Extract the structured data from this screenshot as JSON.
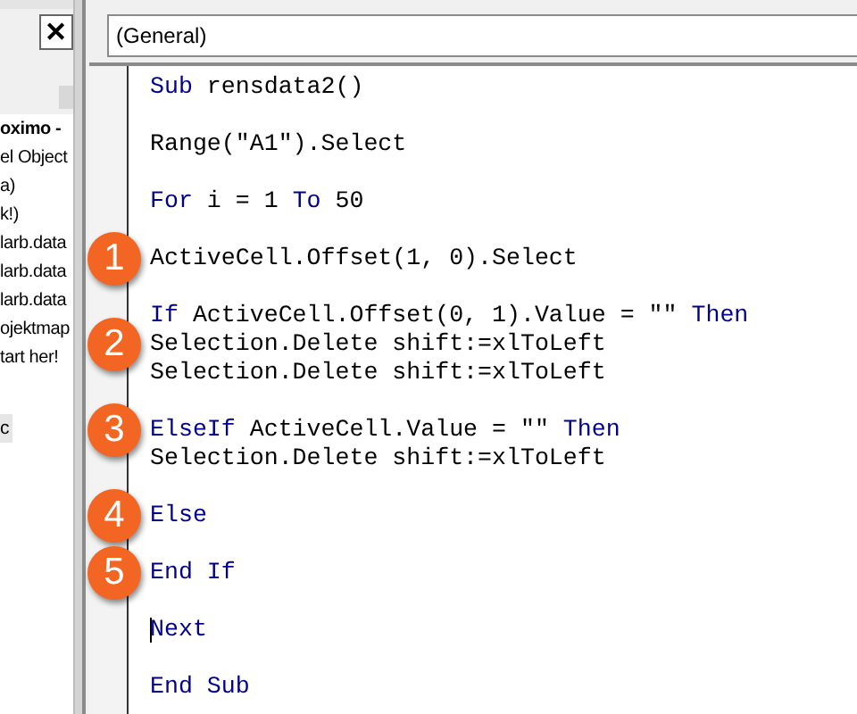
{
  "project_panel": {
    "close": "✕",
    "items": [
      {
        "label": "oximo -",
        "bold": true,
        "selected": false
      },
      {
        "label": "el Object",
        "bold": false,
        "selected": false
      },
      {
        "label": "a)",
        "bold": false,
        "selected": false
      },
      {
        "label": "k!)",
        "bold": false,
        "selected": false
      },
      {
        "label": "larb.data",
        "bold": false,
        "selected": false
      },
      {
        "label": "larb.data",
        "bold": false,
        "selected": false
      },
      {
        "label": "larb.data",
        "bold": false,
        "selected": false
      },
      {
        "label": "ojektmap",
        "bold": false,
        "selected": false
      },
      {
        "label": "tart her!",
        "bold": false,
        "selected": false
      }
    ],
    "properties_item": {
      "label": "c",
      "selected": true
    }
  },
  "code_window": {
    "object_dropdown": "(General)",
    "blocks": [
      {
        "lines": [
          {
            "segments": [
              {
                "text": "Sub",
                "kind": "keyword"
              },
              {
                "text": " rensdata2()",
                "kind": "plain"
              }
            ]
          }
        ]
      },
      {
        "lines": [
          {
            "segments": [
              {
                "text": "Range(\"A1\").Select",
                "kind": "plain"
              }
            ]
          }
        ]
      },
      {
        "lines": [
          {
            "segments": [
              {
                "text": "For",
                "kind": "keyword"
              },
              {
                "text": " i = 1 ",
                "kind": "plain"
              },
              {
                "text": "To",
                "kind": "keyword"
              },
              {
                "text": " 50",
                "kind": "plain"
              }
            ]
          }
        ]
      },
      {
        "lines": [
          {
            "marker": "1",
            "segments": [
              {
                "text": "ActiveCell.Offset(1, 0).Select",
                "kind": "plain"
              }
            ]
          }
        ]
      },
      {
        "lines": [
          {
            "segments": [
              {
                "text": "If",
                "kind": "keyword"
              },
              {
                "text": " ActiveCell.Offset(0, 1).Value = \"\" ",
                "kind": "plain"
              },
              {
                "text": "Then",
                "kind": "keyword"
              }
            ]
          },
          {
            "marker": "2",
            "segments": [
              {
                "text": "Selection.Delete shift:=xlToLeft",
                "kind": "plain"
              }
            ]
          },
          {
            "segments": [
              {
                "text": "Selection.Delete shift:=xlToLeft",
                "kind": "plain"
              }
            ]
          }
        ]
      },
      {
        "lines": [
          {
            "marker": "3",
            "segments": [
              {
                "text": "ElseIf",
                "kind": "keyword"
              },
              {
                "text": " ActiveCell.Value = \"\" ",
                "kind": "plain"
              },
              {
                "text": "Then",
                "kind": "keyword"
              }
            ]
          },
          {
            "segments": [
              {
                "text": "Selection.Delete shift:=xlToLeft",
                "kind": "plain"
              }
            ]
          }
        ]
      },
      {
        "lines": [
          {
            "marker": "4",
            "segments": [
              {
                "text": "Else",
                "kind": "keyword"
              }
            ]
          }
        ]
      },
      {
        "lines": [
          {
            "marker": "5",
            "segments": [
              {
                "text": "End If",
                "kind": "keyword"
              }
            ]
          }
        ]
      },
      {
        "lines": [
          {
            "caret": true,
            "segments": [
              {
                "text": "Next",
                "kind": "keyword"
              }
            ]
          }
        ]
      },
      {
        "lines": [
          {
            "segments": [
              {
                "text": "End Sub",
                "kind": "keyword"
              }
            ]
          }
        ]
      }
    ]
  }
}
